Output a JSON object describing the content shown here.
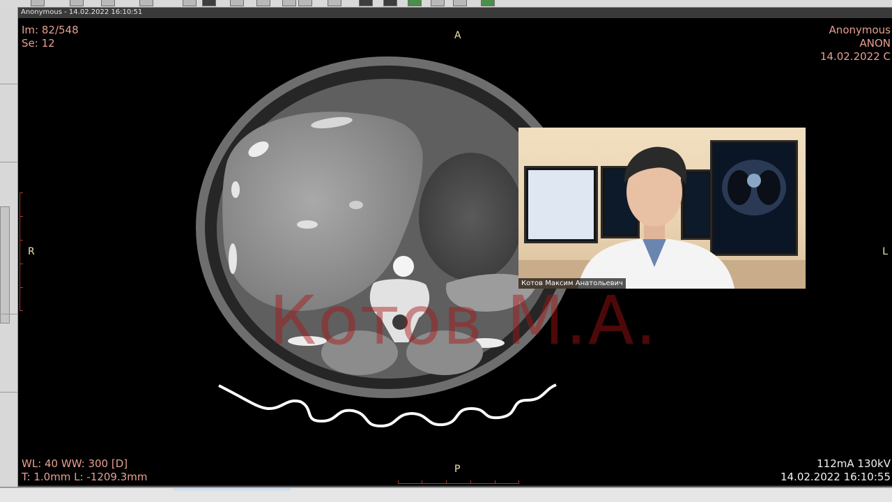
{
  "viewer": {
    "header_title": "Anonymous - 14.02.2022 16:10:51",
    "overlay": {
      "top_left_line1": "Im: 82/548",
      "top_left_line2": "Se: 12",
      "top_right_line1": "Anonymous",
      "top_right_line2": "ANON",
      "top_right_line3": "14.02.2022 C",
      "bottom_left_line1": "WL: 40 WW: 300 [D]",
      "bottom_left_line2": "T: 1.0mm L: -1209.3mm",
      "bottom_right_line1": "112mA 130kV",
      "bottom_right_line2": "14.02.2022 16:10:55",
      "orient_top": "A",
      "orient_bottom": "P",
      "orient_left": "R",
      "orient_right": "L"
    },
    "watermark": "Котов М.А."
  },
  "webcam": {
    "participant_name": "Котов Максим Анатольевич"
  },
  "colors": {
    "overlay_text": "#e7a090",
    "watermark": "#aa1414"
  }
}
